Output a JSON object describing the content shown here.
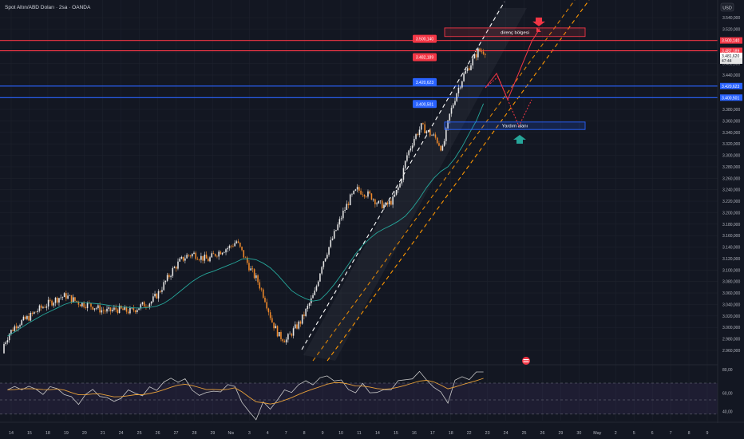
{
  "header": {
    "title": "Spot Altın/ABD Doları · 2sa · OANDA",
    "currency_button": "USD"
  },
  "colors": {
    "background": "#131722",
    "grid": "#1e222d",
    "up": "#e6e6e6",
    "down": "#f0892a",
    "ema": "#26a69a",
    "resistance": "#f23645",
    "support": "#2962ff",
    "channel_white": "#ffffff",
    "channel_orange": "#ff9800",
    "rsi_line": "#c7c7c7",
    "rsi_ma": "#e8a13a",
    "rsi_band": "#7e57c2"
  },
  "zones": {
    "resistance_label": "direnç bölgesi",
    "support_label": "Yardım alanı"
  },
  "price_labels": {
    "left": [
      {
        "text": "3.500,140",
        "value": 3500.14,
        "kind": "resistance"
      },
      {
        "text": "3.482,189",
        "value": 3482.189,
        "kind": "resistance"
      },
      {
        "text": "3.420,623",
        "value": 3420.623,
        "kind": "support"
      },
      {
        "text": "3.400,501",
        "value": 3400.501,
        "kind": "support"
      }
    ],
    "right": [
      {
        "text": "3.500,140",
        "value": 3500.14,
        "kind": "resistance"
      },
      {
        "text": "3.482,189",
        "value": 3482.189,
        "kind": "resistance"
      },
      {
        "text": "3.481,620",
        "value": 3481.62,
        "kind": "current"
      },
      {
        "text": "3.420,623",
        "value": 3420.623,
        "kind": "support"
      },
      {
        "text": "3.400,501",
        "value": 3400.501,
        "kind": "support"
      }
    ],
    "countdown": "47:44"
  },
  "rsi_axis": [
    "80,00",
    "60,00",
    "40,00"
  ],
  "chart_data": {
    "type": "candlestick",
    "ylim": [
      2950,
      3550
    ],
    "y_ticks": [
      "3.540,000",
      "3.520,000",
      "3.500,000",
      "3.480,000",
      "3.460,000",
      "3.440,000",
      "3.420,000",
      "3.400,000",
      "3.380,000",
      "3.360,000",
      "3.340,000",
      "3.320,000",
      "3.300,000",
      "3.280,000",
      "3.260,000",
      "3.240,000",
      "3.220,000",
      "3.200,000",
      "3.180,000",
      "3.160,000",
      "3.140,000",
      "3.120,000",
      "3.100,000",
      "3.080,000",
      "3.060,000",
      "3.040,000",
      "3.020,000",
      "3.000,000",
      "2.980,000",
      "2.960,000"
    ],
    "x_ticks": [
      "14",
      "15",
      "18",
      "19",
      "20",
      "21",
      "24",
      "25",
      "26",
      "27",
      "28",
      "29",
      "Nis",
      "3",
      "4",
      "7",
      "8",
      "9",
      "10",
      "11",
      "14",
      "15",
      "16",
      "17",
      "18",
      "22",
      "23",
      "24",
      "25",
      "26",
      "29",
      "30",
      "May",
      "2",
      "5",
      "6",
      "7",
      "8",
      "9"
    ],
    "close_series": [
      2965,
      2990,
      3005,
      3012,
      3020,
      3030,
      3038,
      3045,
      3052,
      3055,
      3048,
      3042,
      3040,
      3036,
      3030,
      3028,
      3032,
      3030,
      3028,
      3034,
      3040,
      3045,
      3060,
      3080,
      3100,
      3115,
      3125,
      3128,
      3122,
      3118,
      3128,
      3135,
      3140,
      3150,
      3125,
      3100,
      3080,
      3050,
      3010,
      2985,
      2978,
      2995,
      3010,
      3035,
      3060,
      3110,
      3140,
      3170,
      3200,
      3225,
      3240,
      3235,
      3228,
      3215,
      3212,
      3222,
      3250,
      3300,
      3330,
      3350,
      3340,
      3330,
      3310,
      3370,
      3410,
      3440,
      3460,
      3481.62
    ],
    "ema_series": [
      2985,
      2992,
      3000,
      3008,
      3015,
      3022,
      3028,
      3034,
      3040,
      3044,
      3044,
      3043,
      3042,
      3041,
      3039,
      3037,
      3036,
      3035,
      3034,
      3034,
      3035,
      3037,
      3042,
      3050,
      3060,
      3070,
      3080,
      3088,
      3094,
      3098,
      3103,
      3108,
      3113,
      3119,
      3120,
      3118,
      3112,
      3104,
      3092,
      3078,
      3064,
      3056,
      3050,
      3046,
      3048,
      3060,
      3075,
      3092,
      3110,
      3128,
      3143,
      3155,
      3165,
      3172,
      3178,
      3185,
      3194,
      3208,
      3225,
      3244,
      3260,
      3272,
      3280,
      3295,
      3315,
      3338,
      3360,
      3390
    ],
    "rsi": [
      62,
      63,
      66,
      64,
      62,
      60,
      62,
      65,
      58,
      50,
      48,
      56,
      60,
      58,
      50,
      48,
      55,
      58,
      60,
      56,
      62,
      65,
      70,
      74,
      75,
      72,
      62,
      58,
      55,
      63,
      60,
      65,
      70,
      45,
      35,
      30,
      44,
      40,
      52,
      58,
      62,
      68,
      70,
      72,
      74,
      78,
      76,
      70,
      64,
      60,
      66,
      62,
      58,
      60,
      66,
      70,
      74,
      78,
      80,
      76,
      66,
      56,
      50,
      72,
      76,
      78,
      80,
      84
    ]
  }
}
